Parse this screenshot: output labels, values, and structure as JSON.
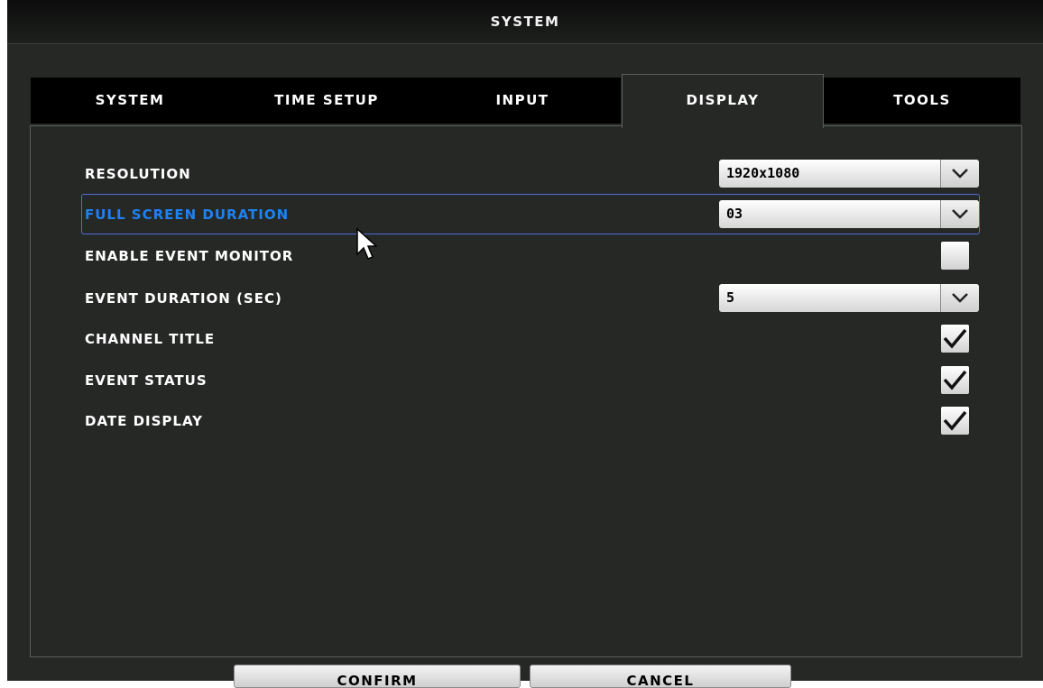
{
  "window": {
    "title": "SYSTEM"
  },
  "tabs": [
    {
      "label": "SYSTEM",
      "active": false
    },
    {
      "label": "TIME SETUP",
      "active": false
    },
    {
      "label": "INPUT",
      "active": false
    },
    {
      "label": "DISPLAY",
      "active": true
    },
    {
      "label": "TOOLS",
      "active": false
    }
  ],
  "settings": {
    "resolution": {
      "label": "RESOLUTION",
      "value": "1920x1080"
    },
    "full_screen_duration": {
      "label": "FULL SCREEN DURATION",
      "value": "03"
    },
    "enable_event_monitor": {
      "label": "ENABLE EVENT MONITOR",
      "checked": false
    },
    "event_duration": {
      "label": "EVENT DURATION (SEC)",
      "value": "5"
    },
    "channel_title": {
      "label": "CHANNEL TITLE",
      "checked": true
    },
    "event_status": {
      "label": "EVENT STATUS",
      "checked": true
    },
    "date_display": {
      "label": "DATE DISPLAY",
      "checked": true
    }
  },
  "buttons": {
    "confirm": "CONFIRM",
    "cancel": "CANCEL"
  },
  "colors": {
    "background": "#262826",
    "highlight_text": "#1e82f0",
    "focus_border": "#4e6cd8"
  }
}
